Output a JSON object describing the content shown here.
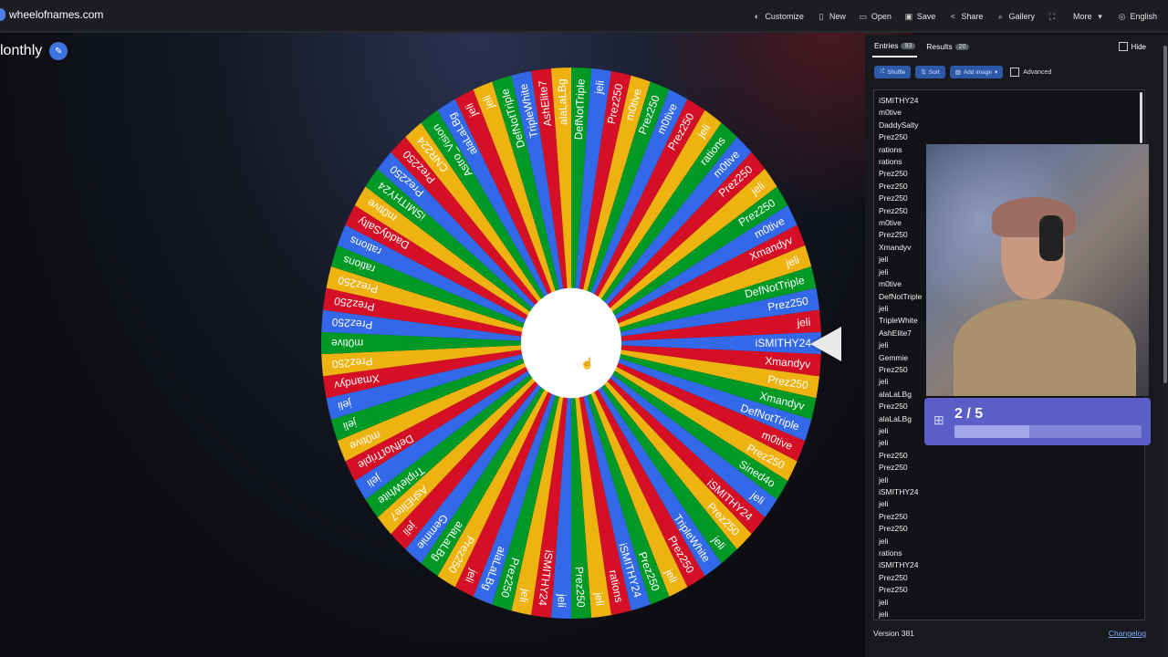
{
  "site": {
    "name": "wheelofnames.com"
  },
  "menu": [
    {
      "label": "Customize",
      "icon": "palette-icon",
      "glyph": "◐"
    },
    {
      "label": "New",
      "icon": "file-icon",
      "glyph": "▯"
    },
    {
      "label": "Open",
      "icon": "folder-icon",
      "glyph": "▭"
    },
    {
      "label": "Save",
      "icon": "save-icon",
      "glyph": "▣"
    },
    {
      "label": "Share",
      "icon": "share-icon",
      "glyph": "<"
    },
    {
      "label": "Gallery",
      "icon": "search-icon",
      "glyph": "⌕"
    },
    {
      "label": "",
      "icon": "fullscreen-icon",
      "glyph": "⛶"
    },
    {
      "label": "More",
      "icon": "chevron-down-icon",
      "glyph": "▾"
    },
    {
      "label": "English",
      "icon": "globe-icon",
      "glyph": "◎"
    }
  ],
  "wheel": {
    "title": "lonthly",
    "colors": [
      "#3369e8",
      "#d50f25",
      "#eeb211",
      "#009925"
    ],
    "segments": [
      "iSMITHY24",
      "Xmandyv",
      "Prez250",
      "Xmandyv",
      "DefNotTriple",
      "m0tive",
      "Prez250",
      "Sined4o",
      "jeli",
      "iSMITHY24",
      "Prez250",
      "jeli",
      "TripleWhite",
      "Prez250",
      "jeli",
      "Prez250",
      "iSMITHY24",
      "rations",
      "jeli",
      "Prez250",
      "jeli",
      "iSMITHY24",
      "jeli",
      "Prez250",
      "alaLaLBg",
      "jeli",
      "Prez250",
      "alaLaLBg",
      "Gemmie",
      "jeli",
      "AshElite7",
      "TripleWhite",
      "jeli",
      "DefNotTriple",
      "m0tive",
      "jeli",
      "jeli",
      "Xmandyv",
      "Prez250",
      "m0tive",
      "Prez250",
      "Prez250",
      "Prez250",
      "rations",
      "rations",
      "DaddySalty",
      "m0tive",
      "iSMITHY24",
      "Prez250",
      "Prez250",
      "CNR224",
      "Astro_Vision",
      "alaLaLBg",
      "jeli",
      "jeli",
      "DefNotTriple",
      "TripleWhite",
      "AshElite7",
      "alaLaLBg",
      "DefNotTriple",
      "jeli",
      "Prez250",
      "m0tive",
      "Prez250",
      "m0tive",
      "Prez250",
      "jeli",
      "rations",
      "m0tive",
      "Prez250",
      "jeli",
      "Prez250",
      "m0tive",
      "Xmandyv",
      "jeli",
      "DefNotTriple",
      "Prez250",
      "jeli"
    ]
  },
  "panel": {
    "tabs": [
      {
        "label": "Entries",
        "count": "93"
      },
      {
        "label": "Results",
        "count": "20"
      }
    ],
    "hide_label": "Hide",
    "toolbar": {
      "shuffle": "Shuffle",
      "sort": "Sort",
      "add_image": "Add image",
      "advanced": "Advanced"
    },
    "entries": [
      "iSMITHY24",
      "m0tive",
      "DaddySalty",
      "Prez250",
      "rations",
      "rations",
      "Prez250",
      "Prez250",
      "Prez250",
      "Prez250",
      "m0tive",
      "Prez250",
      "Xmandyv",
      "jeli",
      "jeli",
      "m0tive",
      "DefNotTriple",
      "jeli",
      "TripleWhite",
      "AshElite7",
      "jeli",
      "Gemmie",
      "Prez250",
      "jeli",
      "alaLaLBg",
      "Prez250",
      "alaLaLBg",
      "jeli",
      "jeli",
      "Prez250",
      "Prez250",
      "jeli",
      "iSMITHY24",
      "jeli",
      "Prez250",
      "Prez250",
      "jeli",
      "rations",
      "iSMITHY24",
      "Prez250",
      "Prez250",
      "jeli",
      "jeli"
    ],
    "version": "Version 381",
    "changelog": "Changelog"
  },
  "overlay": {
    "progress_text": "2 / 5",
    "progress": 0.4
  }
}
